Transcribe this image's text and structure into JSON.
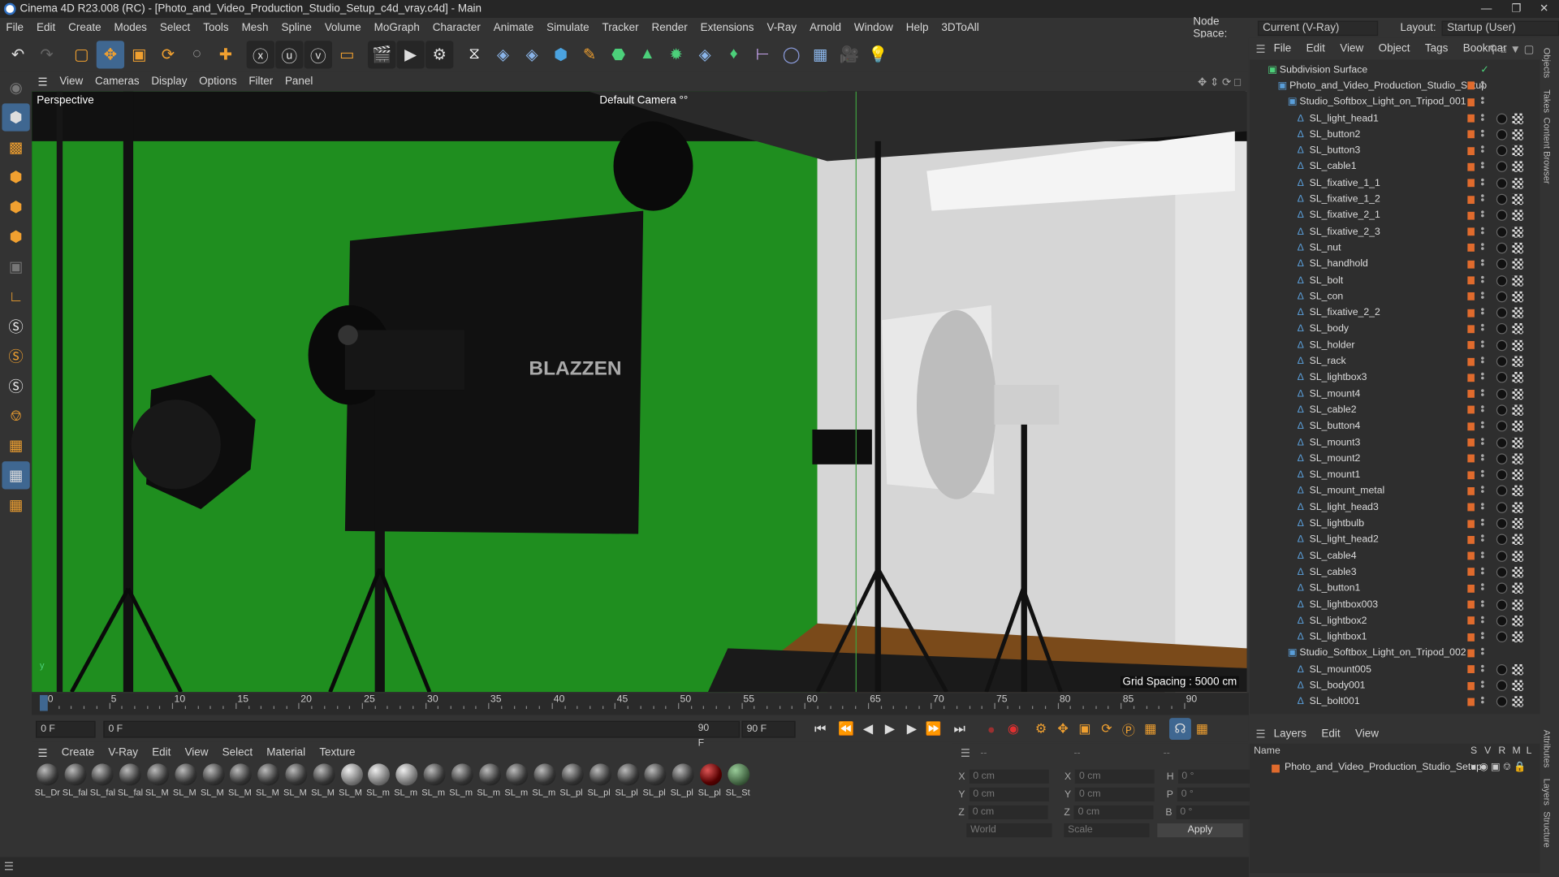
{
  "title": "Cinema 4D R23.008 (RC) - [Photo_and_Video_Production_Studio_Setup_c4d_vray.c4d] - Main",
  "menu": [
    "File",
    "Edit",
    "Create",
    "Modes",
    "Select",
    "Tools",
    "Mesh",
    "Spline",
    "Volume",
    "MoGraph",
    "Character",
    "Animate",
    "Simulate",
    "Tracker",
    "Render",
    "Extensions",
    "V-Ray",
    "Arnold",
    "Window",
    "Help",
    "3DToAll"
  ],
  "node_space": {
    "label": "Node Space:",
    "value": "Current (V-Ray)"
  },
  "layout": {
    "label": "Layout:",
    "value": "Startup (User)"
  },
  "viewport_menu": [
    "View",
    "Cameras",
    "Display",
    "Options",
    "Filter",
    "Panel"
  ],
  "viewport": {
    "label": "Perspective",
    "camera": "Default Camera °°",
    "grid": "Grid Spacing : 5000 cm",
    "screen_text": "BLAZZEN"
  },
  "timeline": {
    "ticks": [
      "0",
      "5",
      "10",
      "15",
      "20",
      "25",
      "30",
      "35",
      "40",
      "45",
      "50",
      "55",
      "60",
      "65",
      "70",
      "75",
      "80",
      "85",
      "90"
    ],
    "current": "0 F"
  },
  "transport": {
    "start": "0 F",
    "current": "0 F",
    "end": "90 F",
    "end2": "90 F"
  },
  "material_menu": [
    "Create",
    "V-Ray",
    "Edit",
    "View",
    "Select",
    "Material",
    "Texture"
  ],
  "materials": [
    "SL_Dr",
    "SL_fal",
    "SL_fal",
    "SL_fal",
    "SL_M",
    "SL_M",
    "SL_M",
    "SL_M",
    "SL_M",
    "SL_M",
    "SL_M",
    "SL_M",
    "SL_m",
    "SL_m",
    "SL_m",
    "SL_m",
    "SL_m",
    "SL_m",
    "SL_m",
    "SL_pl",
    "SL_pl",
    "SL_pl",
    "SL_pl",
    "SL_pl",
    "SL_pl",
    "SL_St"
  ],
  "coords": {
    "x1": "0 cm",
    "y1": "0 cm",
    "z1": "0 cm",
    "x2": "0 cm",
    "y2": "0 cm",
    "z2": "0 cm",
    "h": "0 °",
    "p": "0 °",
    "b": "0 °",
    "world": "World",
    "scale": "Scale",
    "apply": "Apply",
    "dash1": "--",
    "dash2": "--",
    "dash3": "--"
  },
  "obj_menu": [
    "File",
    "Edit",
    "View",
    "Object",
    "Tags",
    "Bookmar"
  ],
  "objects": [
    {
      "name": "Subdivision Surface",
      "indent": 0
    },
    {
      "name": "Photo_and_Video_Production_Studio_Setup",
      "indent": 1
    },
    {
      "name": "Studio_Softbox_Light_on_Tripod_001",
      "indent": 2
    },
    {
      "name": "SL_light_head1",
      "indent": 3
    },
    {
      "name": "SL_button2",
      "indent": 3
    },
    {
      "name": "SL_button3",
      "indent": 3
    },
    {
      "name": "SL_cable1",
      "indent": 3
    },
    {
      "name": "SL_fixative_1_1",
      "indent": 3
    },
    {
      "name": "SL_fixative_1_2",
      "indent": 3
    },
    {
      "name": "SL_fixative_2_1",
      "indent": 3
    },
    {
      "name": "SL_fixative_2_3",
      "indent": 3
    },
    {
      "name": "SL_nut",
      "indent": 3
    },
    {
      "name": "SL_handhold",
      "indent": 3
    },
    {
      "name": "SL_bolt",
      "indent": 3
    },
    {
      "name": "SL_con",
      "indent": 3
    },
    {
      "name": "SL_fixative_2_2",
      "indent": 3
    },
    {
      "name": "SL_body",
      "indent": 3
    },
    {
      "name": "SL_holder",
      "indent": 3
    },
    {
      "name": "SL_rack",
      "indent": 3
    },
    {
      "name": "SL_lightbox3",
      "indent": 3
    },
    {
      "name": "SL_mount4",
      "indent": 3
    },
    {
      "name": "SL_cable2",
      "indent": 3
    },
    {
      "name": "SL_button4",
      "indent": 3
    },
    {
      "name": "SL_mount3",
      "indent": 3
    },
    {
      "name": "SL_mount2",
      "indent": 3
    },
    {
      "name": "SL_mount1",
      "indent": 3
    },
    {
      "name": "SL_mount_metal",
      "indent": 3
    },
    {
      "name": "SL_light_head3",
      "indent": 3
    },
    {
      "name": "SL_lightbulb",
      "indent": 3
    },
    {
      "name": "SL_light_head2",
      "indent": 3
    },
    {
      "name": "SL_cable4",
      "indent": 3
    },
    {
      "name": "SL_cable3",
      "indent": 3
    },
    {
      "name": "SL_button1",
      "indent": 3
    },
    {
      "name": "SL_lightbox003",
      "indent": 3
    },
    {
      "name": "SL_lightbox2",
      "indent": 3
    },
    {
      "name": "SL_lightbox1",
      "indent": 3
    },
    {
      "name": "Studio_Softbox_Light_on_Tripod_002",
      "indent": 2
    },
    {
      "name": "SL_mount005",
      "indent": 3
    },
    {
      "name": "SL_body001",
      "indent": 3
    },
    {
      "name": "SL_bolt001",
      "indent": 3
    }
  ],
  "layers_menu": [
    "Layers",
    "Edit",
    "View"
  ],
  "layers": {
    "header_name": "Name",
    "cols": [
      "S",
      "V",
      "R",
      "M",
      "L"
    ],
    "row": "Photo_and_Video_Production_Studio_Setup"
  },
  "side_tabs": [
    "Objects",
    "Takes",
    "Content Browser",
    "Attributes",
    "Layers",
    "Structure"
  ]
}
